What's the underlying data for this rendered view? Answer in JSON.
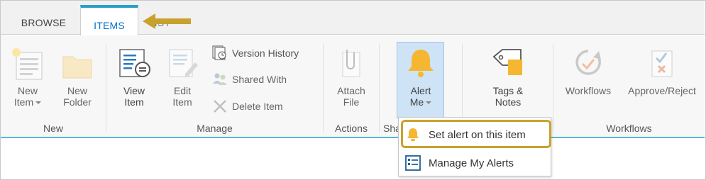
{
  "tabs": [
    {
      "label": "BROWSE"
    },
    {
      "label": "ITEMS"
    },
    {
      "label": "LIST"
    }
  ],
  "groups": {
    "new": {
      "label": "New",
      "new_item": "New Item",
      "new_folder_line1": "New",
      "new_folder_line2": "Folder",
      "new_item_line1": "New",
      "new_item_line2": "Item"
    },
    "manage": {
      "label": "Manage",
      "view_line1": "View",
      "view_line2": "Item",
      "edit_line1": "Edit",
      "edit_line2": "Item",
      "version_history": "Version History",
      "shared_with": "Shared With",
      "delete_item": "Delete Item"
    },
    "actions": {
      "label": "Actions",
      "attach_line1": "Attach",
      "attach_line2": "File"
    },
    "share": {
      "label": "Share & Track",
      "label_visible": "Sha",
      "alert_line1": "Alert",
      "alert_line2": "Me"
    },
    "tags": {
      "tags_line1": "Tags &",
      "tags_line2": "Notes"
    },
    "workflows": {
      "label": "Workflows",
      "workflows": "Workflows",
      "approve_reject": "Approve/Reject"
    }
  },
  "alert_menu": {
    "items": [
      {
        "label": "Set alert on this item",
        "icon": "bell-icon",
        "highlighted": true
      },
      {
        "label": "Manage My Alerts",
        "icon": "list-icon"
      }
    ]
  },
  "colors": {
    "accent": "#0072c6",
    "tab_top_border": "#2aa0c8",
    "ribbon_bottom": "#59b7d6",
    "highlight": "#c7a32e",
    "bell": "#f5b731",
    "alert_selected_bg": "#cfe3f6"
  }
}
